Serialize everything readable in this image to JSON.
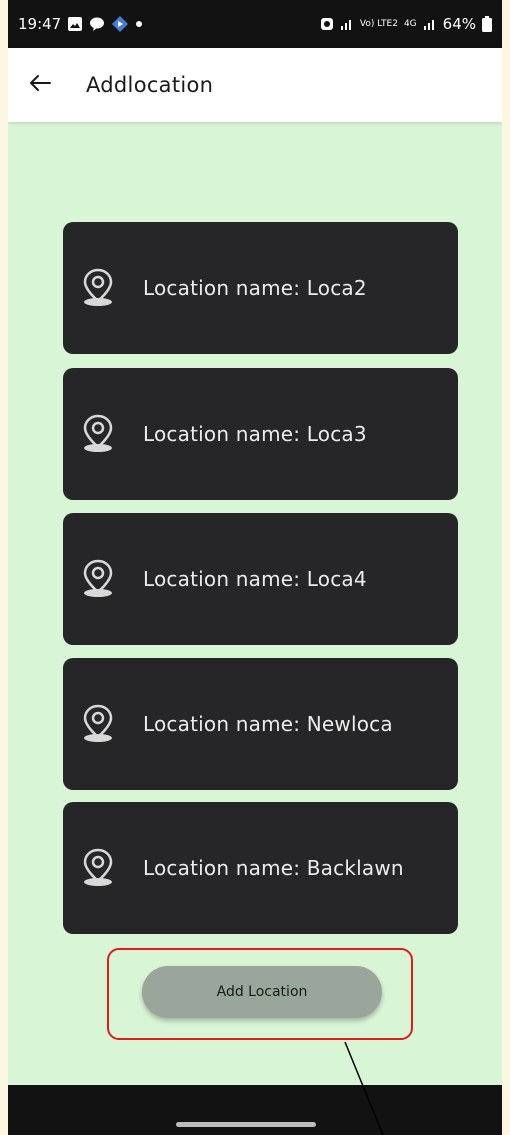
{
  "status_bar": {
    "time": "19:47",
    "network_small": "Vo) LTE2",
    "network_4g": "4G",
    "battery": "64%"
  },
  "app_bar": {
    "title": "Addlocation",
    "back_icon": "arrow-left-icon"
  },
  "locations": [
    {
      "label": "Location name: Loca2",
      "icon": "location-pin-icon"
    },
    {
      "label": "Location name: Loca3",
      "icon": "location-pin-icon"
    },
    {
      "label": "Location name: Loca4",
      "icon": "location-pin-icon"
    },
    {
      "label": "Location name: Newloca",
      "icon": "location-pin-icon"
    },
    {
      "label": "Location name: Backlawn",
      "icon": "location-pin-icon"
    }
  ],
  "add_button": {
    "label": "Add Location"
  },
  "colors": {
    "background": "#d8f5d6",
    "card": "#262628",
    "button": "#9aa69b",
    "highlight": "#e21c1c"
  }
}
